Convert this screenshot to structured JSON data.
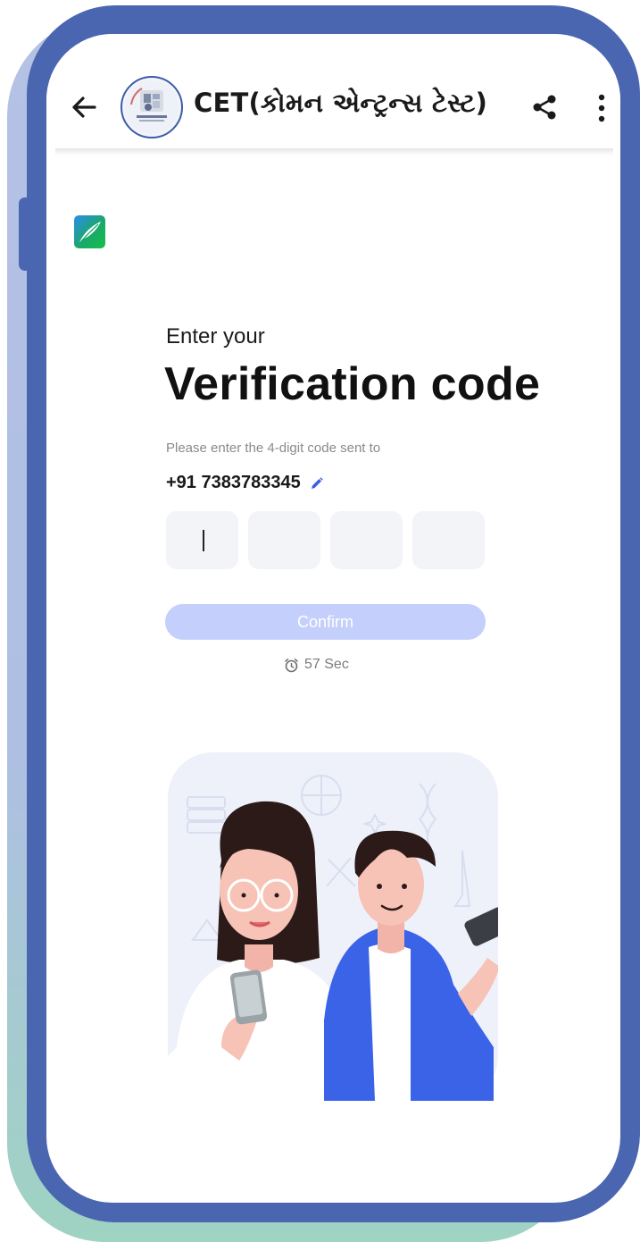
{
  "header": {
    "title": "CET(કોમન એન્ટ્રન્સ ટેસ્ટ)",
    "back_icon": "arrow-left-icon",
    "share_icon": "share-icon",
    "more_icon": "more-vertical-icon"
  },
  "verification": {
    "subtitle": "Enter your",
    "headline": "Verification code",
    "instruction": "Please enter the 4-digit code sent to",
    "phone_number": "+91 7383783345",
    "edit_icon": "pencil-icon",
    "otp_digits": [
      "",
      "",
      "",
      ""
    ],
    "confirm_label": "Confirm",
    "timer_icon": "alarm-clock-icon",
    "timer_text": "57 Sec"
  },
  "colors": {
    "frame": "#4a66b0",
    "confirm_disabled": "#c4cffb",
    "accent": "#3b5ce4",
    "otp_box": "#f3f4f8"
  }
}
